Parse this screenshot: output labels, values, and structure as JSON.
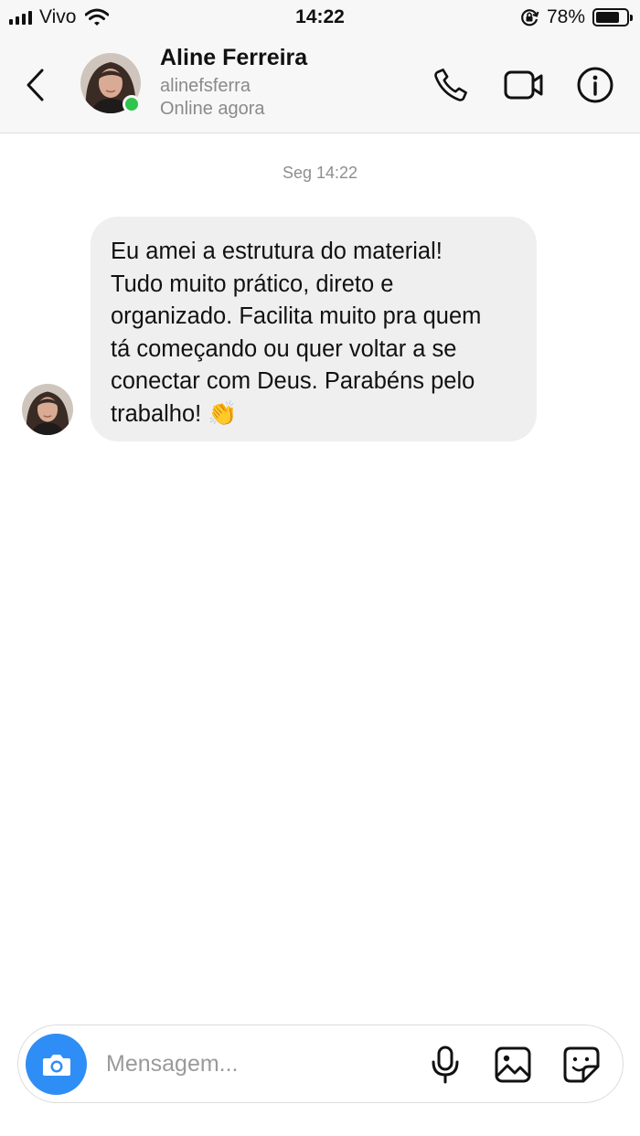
{
  "status_bar": {
    "carrier": "Vivo",
    "time": "14:22",
    "battery_percent_label": "78%",
    "battery_level": 0.78,
    "icons": [
      "signal-icon",
      "wifi-icon",
      "rotation-lock-icon",
      "battery-icon"
    ]
  },
  "header": {
    "contact_name": "Aline Ferreira",
    "contact_handle": "alinefsferra",
    "contact_status": "Online agora",
    "online_color": "#2ec54a",
    "icons": [
      "back-chevron-icon",
      "phone-icon",
      "video-camera-icon",
      "info-icon"
    ]
  },
  "conversation": {
    "timestamp": "Seg 14:22",
    "messages": [
      {
        "sender": "Aline Ferreira",
        "text": "Eu amei a estrutura do material!\nTudo muito prático, direto e\norganizado. Facilita muito pra quem\ntá começando ou quer voltar a se\nconectar com Deus. Parabéns pelo\ntrabalho! ",
        "emoji": "👏"
      }
    ]
  },
  "composer": {
    "placeholder": "Mensagem...",
    "accent_color": "#2f8ef5",
    "icons": [
      "camera-icon",
      "microphone-icon",
      "gallery-icon",
      "sticker-icon"
    ]
  }
}
